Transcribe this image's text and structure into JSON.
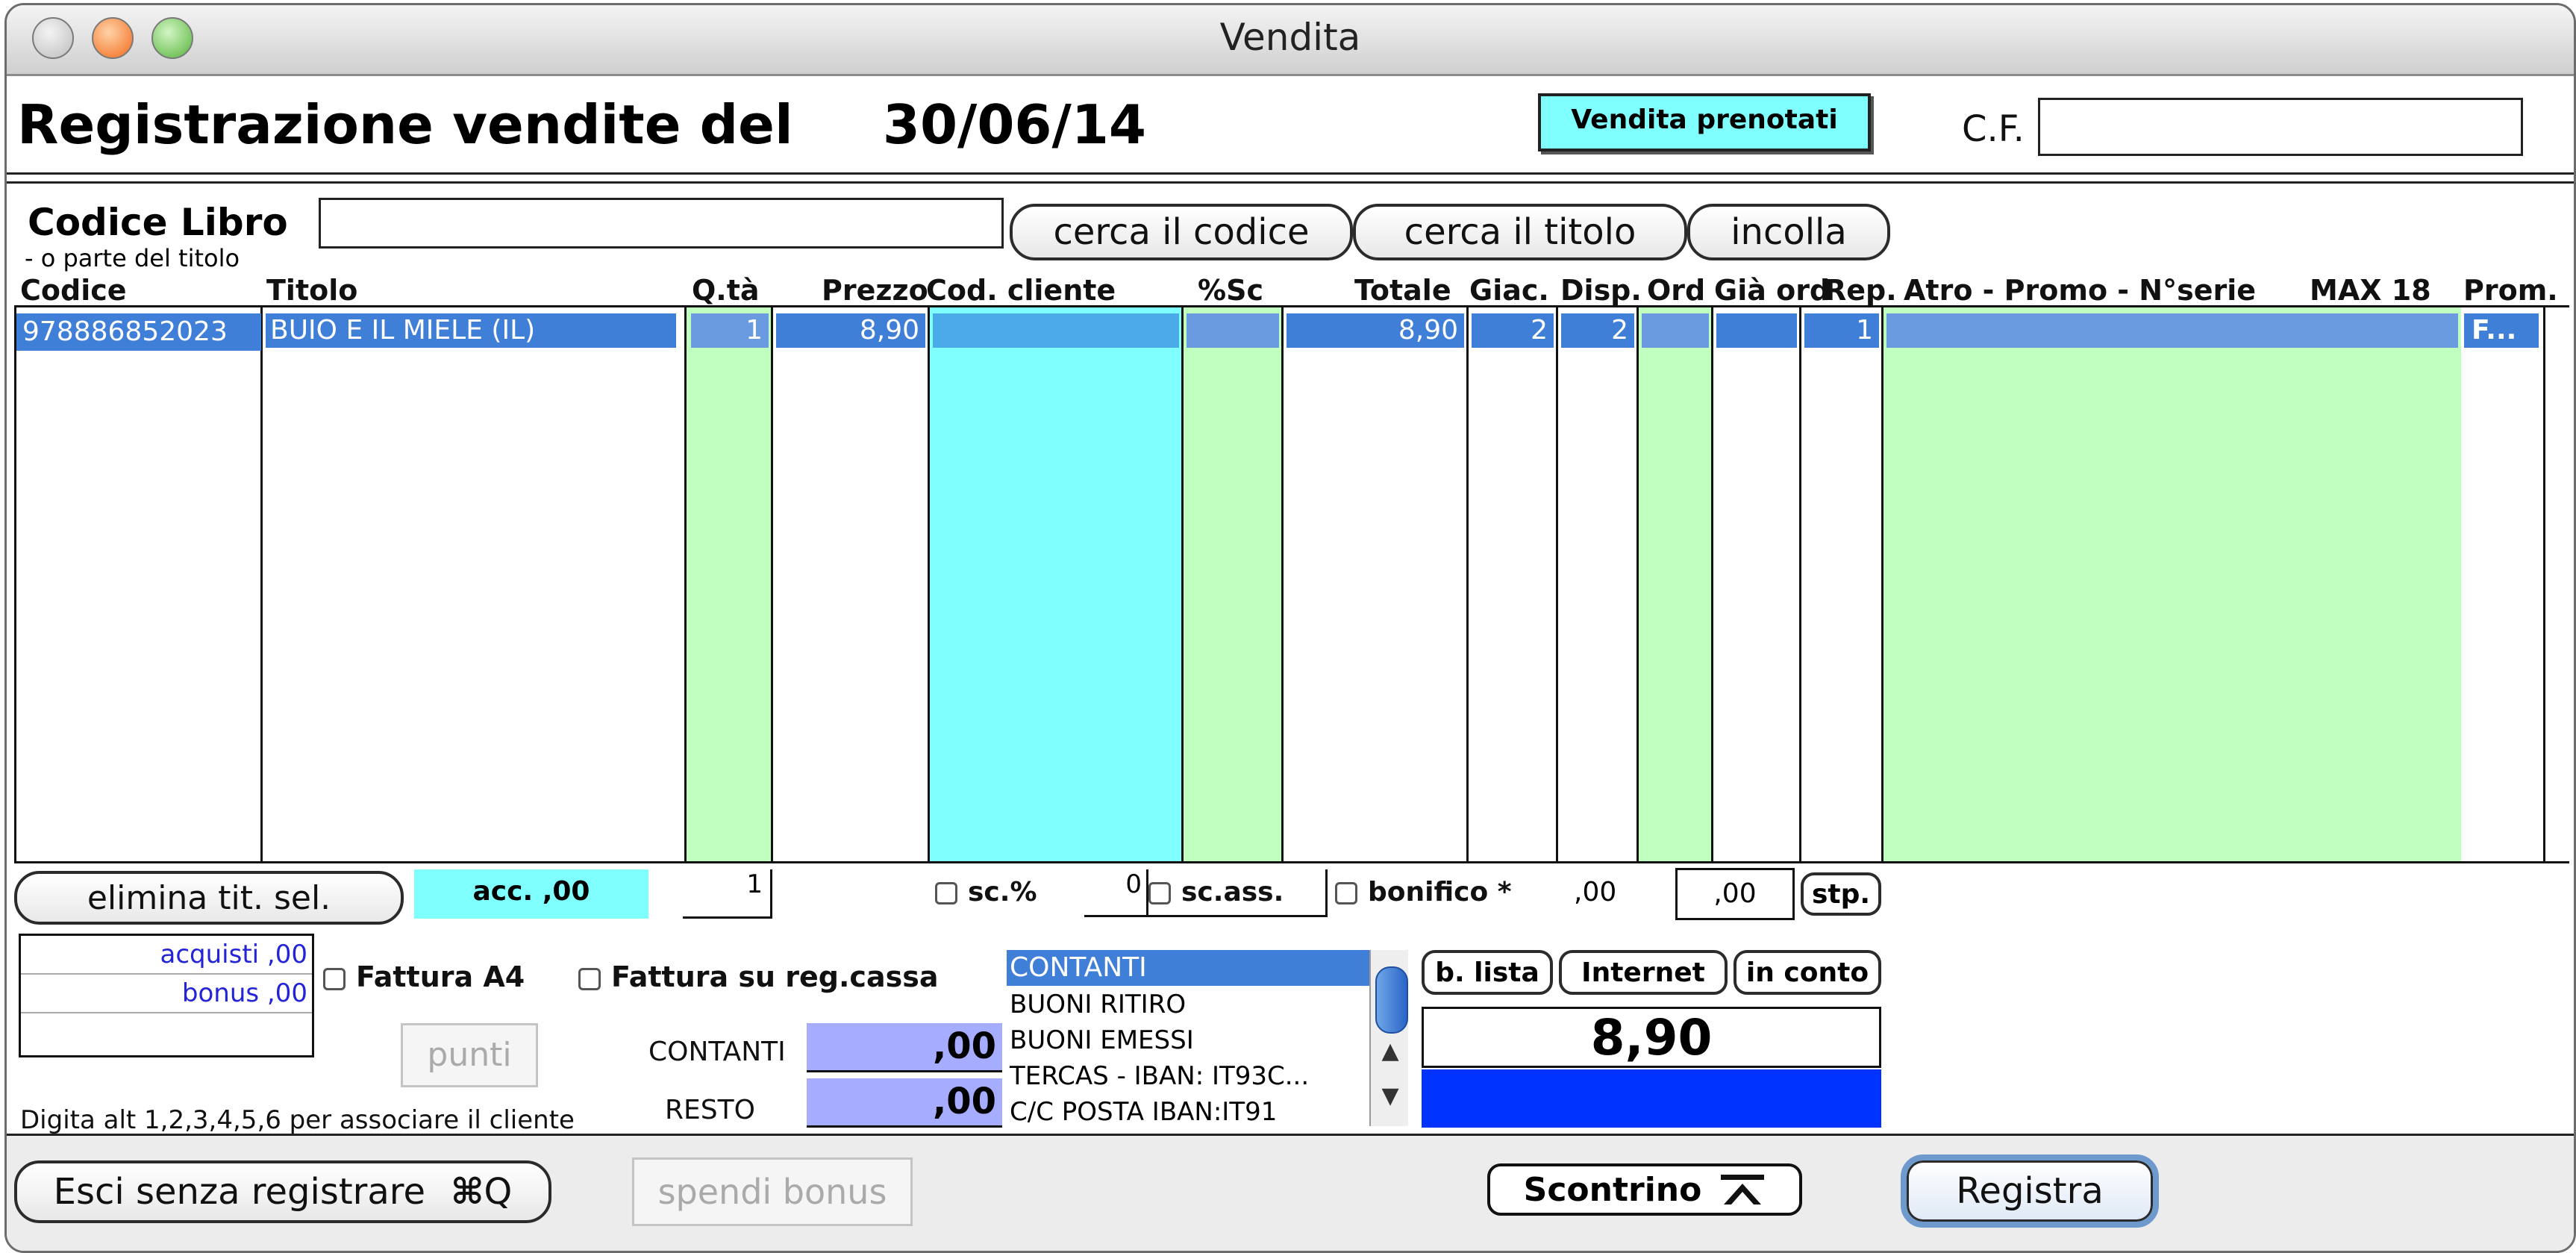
{
  "window": {
    "title": "Vendita"
  },
  "header": {
    "title_prefix": "Registrazione vendite del",
    "date": "30/06/14",
    "booked_sales_button": "Vendita prenotati",
    "cf_label": "C.F.",
    "cf_value": ""
  },
  "search": {
    "label": "Codice Libro",
    "sublabel": "- o parte del  titolo",
    "value": "",
    "buttons": {
      "search_code": "cerca il codice",
      "search_title": "cerca il titolo",
      "paste": "incolla"
    }
  },
  "table": {
    "headers": {
      "codice": "Codice",
      "titolo": "Titolo",
      "qta": "Q.tà",
      "prezzo": "Prezzo",
      "cod_cliente": "Cod. cliente",
      "sc": "%Sc",
      "totale": "Totale",
      "giac": "Giac.",
      "disp": "Disp.",
      "ord": "Ord",
      "gia_ord": "Già ord",
      "rep": "Rep.",
      "altro": "Atro - Promo - N°serie",
      "max": "MAX 18",
      "prom": "Prom."
    },
    "rows": [
      {
        "codice": "978886852023",
        "titolo": "BUIO E IL MIELE (IL)",
        "qta": "1",
        "prezzo": "8,90",
        "cod_cliente": "",
        "sc": "",
        "totale": "8,90",
        "giac": "2",
        "disp": "2",
        "ord": "",
        "gia_ord": "",
        "rep": "1",
        "altro": "",
        "prom": "F..."
      }
    ]
  },
  "footer_row": {
    "delete_button": "elimina tit. sel.",
    "acc": "acc. ,00",
    "qty": "1",
    "sc_pct_label": "sc.%",
    "sc_pct_value": "0",
    "sc_ass_label": "sc.ass.",
    "bonifico_label": "bonifico *",
    "bonifico_value": ",00",
    "extra_value": ",00",
    "stp": "stp."
  },
  "customer": {
    "acquisti": "acquisti ,00",
    "bonus": "bonus ,00",
    "fattura_a4": "Fattura A4",
    "fattura_cassa": "Fattura su reg.cassa",
    "punti": "punti",
    "hint": "Digita alt 1,2,3,4,5,6 per associare il cliente"
  },
  "payment": {
    "contanti_label": "CONTANTI",
    "contanti_value": ",00",
    "resto_label": "RESTO",
    "resto_value": ",00",
    "methods": [
      "CONTANTI",
      "BUONI RITIRO",
      "BUONI EMESSI",
      "TERCAS - IBAN: IT93C...",
      "C/C POSTA IBAN:IT91"
    ],
    "b_lista": "b. lista",
    "internet": "Internet",
    "in_conto": "in conto",
    "total": "8,90"
  },
  "bottom": {
    "exit": "Esci senza registrare",
    "exit_shortcut": "Q",
    "spend_bonus": "spendi bonus",
    "scontrino": "Scontrino",
    "register": "Registra"
  },
  "colors": {
    "selection": "#3f7fd8",
    "cyan": "#80ffff",
    "green": "#c0ffc0",
    "lavender": "#a6acff",
    "blue": "#0033ff"
  }
}
